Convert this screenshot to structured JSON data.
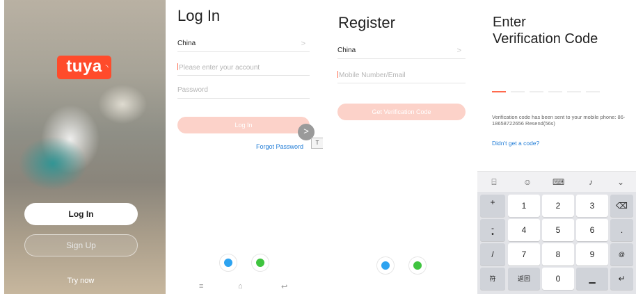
{
  "splash": {
    "logo_text": "tuya",
    "login_label": "Log In",
    "signup_label": "Sign Up",
    "try_now": "Try now"
  },
  "login": {
    "title": "Log In",
    "country": "China",
    "account_placeholder": "Please enter your account",
    "password_placeholder": "Password",
    "login_button": "Log In",
    "forgot_password": "Forgot Password",
    "fab_icon": "chevron-right-icon",
    "tab_mark": "T"
  },
  "register": {
    "title": "Register",
    "country": "China",
    "mobile_placeholder": "Mobile Number/Email",
    "get_code_button": "Get Verification Code"
  },
  "verify": {
    "title_line1": "Enter",
    "title_line2": "Verification Code",
    "sent_text": "Verification code has been sent to your mobile phone: 86-18658722656  Resend(56s)",
    "didnt_get": "Didn't get a code?",
    "keys": {
      "plus": "+",
      "minus": "-",
      "dot": "•",
      "slash": "/",
      "sym": "符",
      "k1": "1",
      "k2": "2",
      "k3": "3",
      "k4": "4",
      "k5": "5",
      "k6": "6",
      "k7": "7",
      "k8": "8",
      "k9": "9",
      "k0": "0",
      "back": "返回",
      "period": ".",
      "at": "@"
    }
  },
  "colors": {
    "brand": "#ff4b2b",
    "button_disabled": "#fcd2c9",
    "link": "#1f7bd6",
    "qq": "#2da3f0",
    "wechat": "#3fc43f"
  }
}
